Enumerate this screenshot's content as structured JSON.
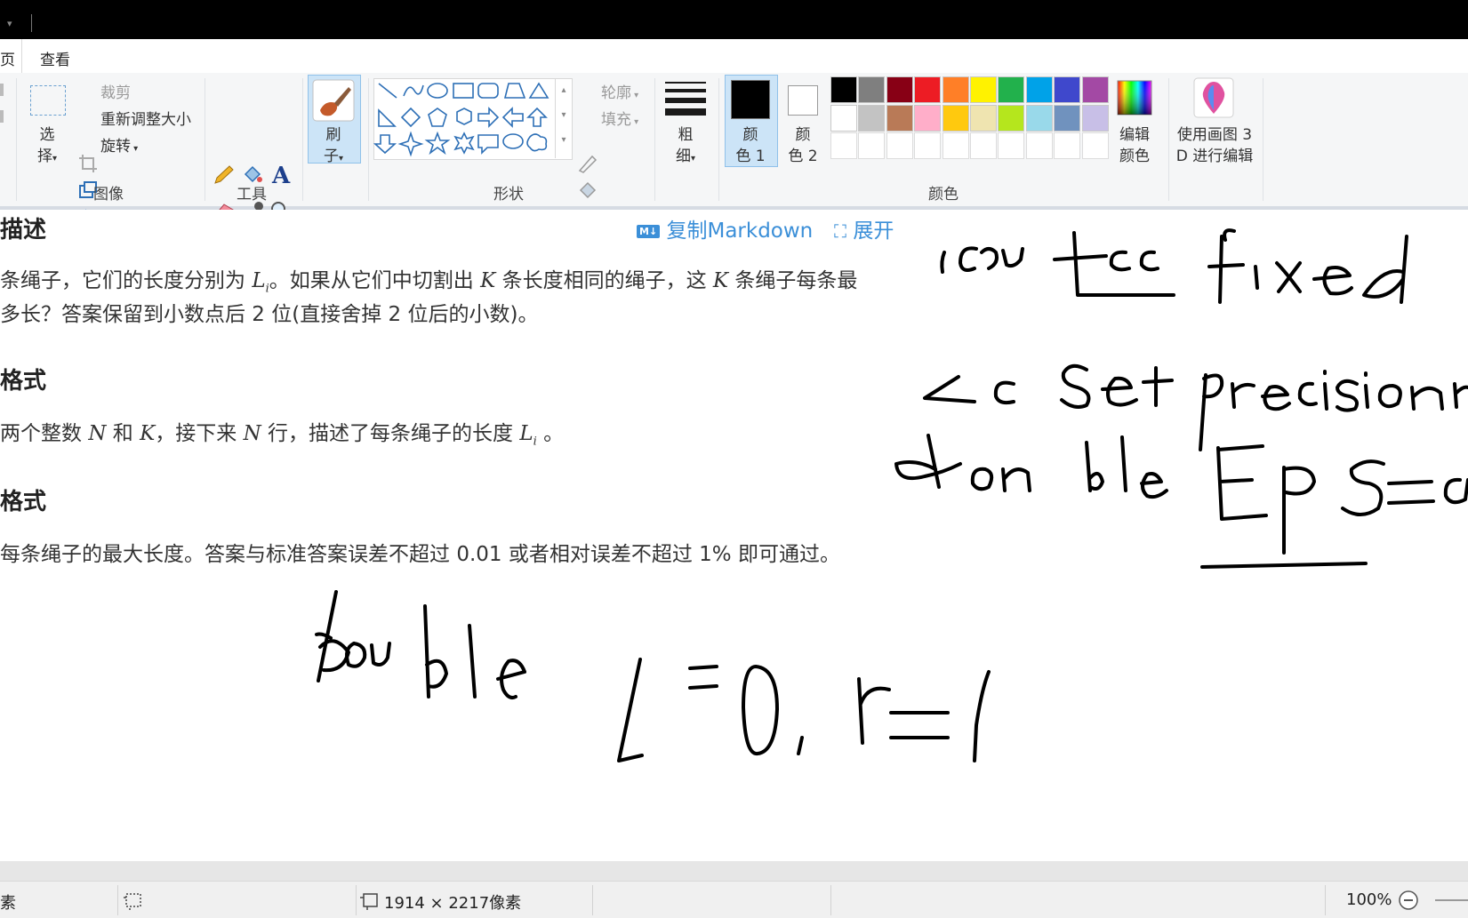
{
  "menu": {
    "tab_home_fragment": "页",
    "tab_view": "查看"
  },
  "ribbon": {
    "image_group": {
      "select_line1": "选",
      "select_line2": "择",
      "crop": "裁剪",
      "resize": "重新调整大小",
      "rotate": "旋转",
      "label": "图像"
    },
    "tools_group": {
      "label": "工具"
    },
    "brush": {
      "line1": "刷",
      "line2": "子"
    },
    "shapes_group": {
      "outline": "轮廓",
      "fill": "填充",
      "label": "形状"
    },
    "size": {
      "line1": "粗",
      "line2": "细"
    },
    "color1": {
      "line1": "颜",
      "line2": "色 1",
      "value": "#000000"
    },
    "color2": {
      "line1": "颜",
      "line2": "色 2",
      "value": "#ffffff"
    },
    "palette": {
      "row1": [
        "#000000",
        "#7f7f7f",
        "#880015",
        "#ed1c24",
        "#ff7f27",
        "#fff200",
        "#22b14c",
        "#00a2e8",
        "#3f48cc",
        "#a349a4"
      ],
      "row2": [
        "#ffffff",
        "#c3c3c3",
        "#b97a57",
        "#ffaec9",
        "#ffc90e",
        "#efe4b0",
        "#b5e61d",
        "#99d9ea",
        "#7092be",
        "#c8bfe7"
      ]
    },
    "edit_colors": {
      "line1": "编辑",
      "line2": "颜色"
    },
    "paint3d": {
      "line1": "使用画图 3",
      "line2": "D 进行编辑"
    },
    "colors_group": {
      "label": "颜色"
    }
  },
  "document": {
    "heading_desc": "描述",
    "copy_markdown": "复制Markdown",
    "expand": "展开",
    "desc_line1_a": "条绳子，它们的长度分别为",
    "desc_line1_b": "。如果从它们中切割出",
    "desc_line1_c": "条长度相同的绳子，这",
    "desc_line1_d": "条绳子每条最",
    "desc_line2": "多长？答案保留到小数点后 2 位(直接舍掉 2 位后的小数)。",
    "heading_input": "格式",
    "input_a": "两个整数",
    "input_b": "和",
    "input_c": "，接下来",
    "input_d": "行，描述了每条绳子的长度",
    "input_e": "。",
    "heading_output": "格式",
    "output_a": "每条绳子的最大长度。答案与标准答案误差不超过",
    "output_b": "0.01",
    "output_c": "或者相对误差不超过",
    "output_d": "1%",
    "output_e": "即可通过。",
    "var_L": "L",
    "var_i": "i",
    "var_K": "K",
    "var_N": "N"
  },
  "status": {
    "left_fragment": "素",
    "dimensions": "1914 × 2217像素",
    "zoom": "100%"
  }
}
